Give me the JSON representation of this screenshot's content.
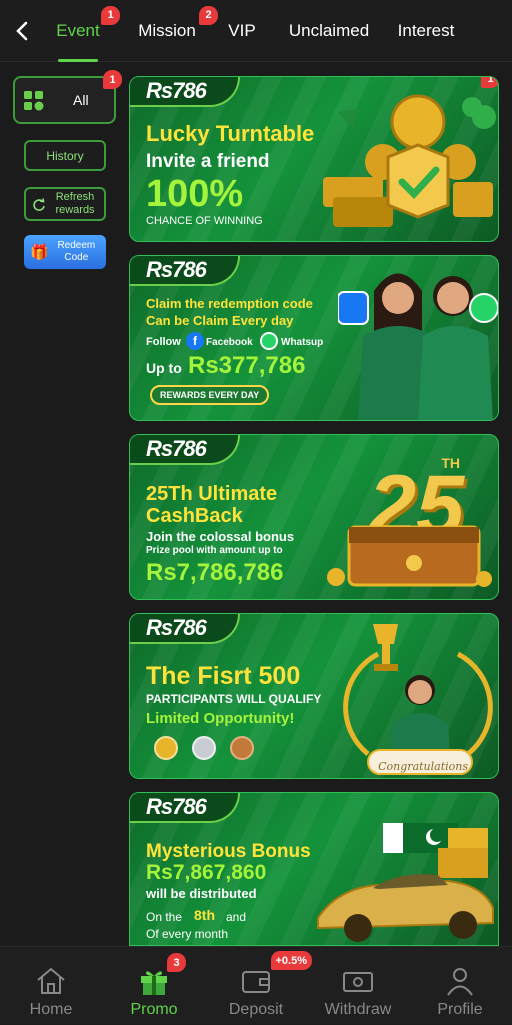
{
  "nav": {
    "tabs": [
      {
        "label": "Event",
        "badge": "1"
      },
      {
        "label": "Mission",
        "badge": "2"
      },
      {
        "label": "VIP"
      },
      {
        "label": "Unclaimed"
      },
      {
        "label": "Interest"
      }
    ]
  },
  "sidebar": {
    "all": {
      "label": "All",
      "badge": "1"
    },
    "history": "History",
    "refresh": "Refresh rewards",
    "redeem": "Redeem Code"
  },
  "banners": [
    {
      "logo": "Rs786",
      "badge": "1",
      "title": "Lucky Turntable",
      "subtitle": "Invite a friend",
      "big": "100%",
      "small": "CHANCE OF WINNING"
    },
    {
      "logo": "Rs786",
      "line1": "Claim the redemption code",
      "line2": "Can be Claim Every day",
      "follow": "Follow",
      "facebook": "Facebook",
      "whatsup": "Whatsup",
      "upto": "Up to",
      "amount": "Rs377,786",
      "button": "REWARDS EVERY DAY"
    },
    {
      "logo": "Rs786",
      "title1": "25Th Ultimate",
      "title2": "CashBack",
      "line1": "Join the colossal bonus",
      "line2": "Prize pool with amount up to",
      "amount": "Rs7,786,786",
      "art": "25",
      "art_sup": "TH"
    },
    {
      "logo": "Rs786",
      "title": "The Fisrt 500",
      "line1": "PARTICIPANTS WILL QUALIFY",
      "line2": "Limited Opportunity!",
      "congrats": "Congratulations"
    },
    {
      "logo": "Rs786",
      "title": "Mysterious Bonus",
      "amount": "Rs7,867,860",
      "line1": "will be distributed",
      "on_the": "On the",
      "eighth": "8th",
      "and": "and",
      "line3": "Of every month"
    }
  ],
  "bottom": {
    "items": [
      {
        "label": "Home"
      },
      {
        "label": "Promo",
        "badge": "3"
      },
      {
        "label": "Deposit",
        "badge": "+0.5%"
      },
      {
        "label": "Withdraw"
      },
      {
        "label": "Profile"
      }
    ]
  },
  "colors": {
    "accent": "#5fd34a",
    "badge": "#e83a3a",
    "banner": "#14933b"
  }
}
